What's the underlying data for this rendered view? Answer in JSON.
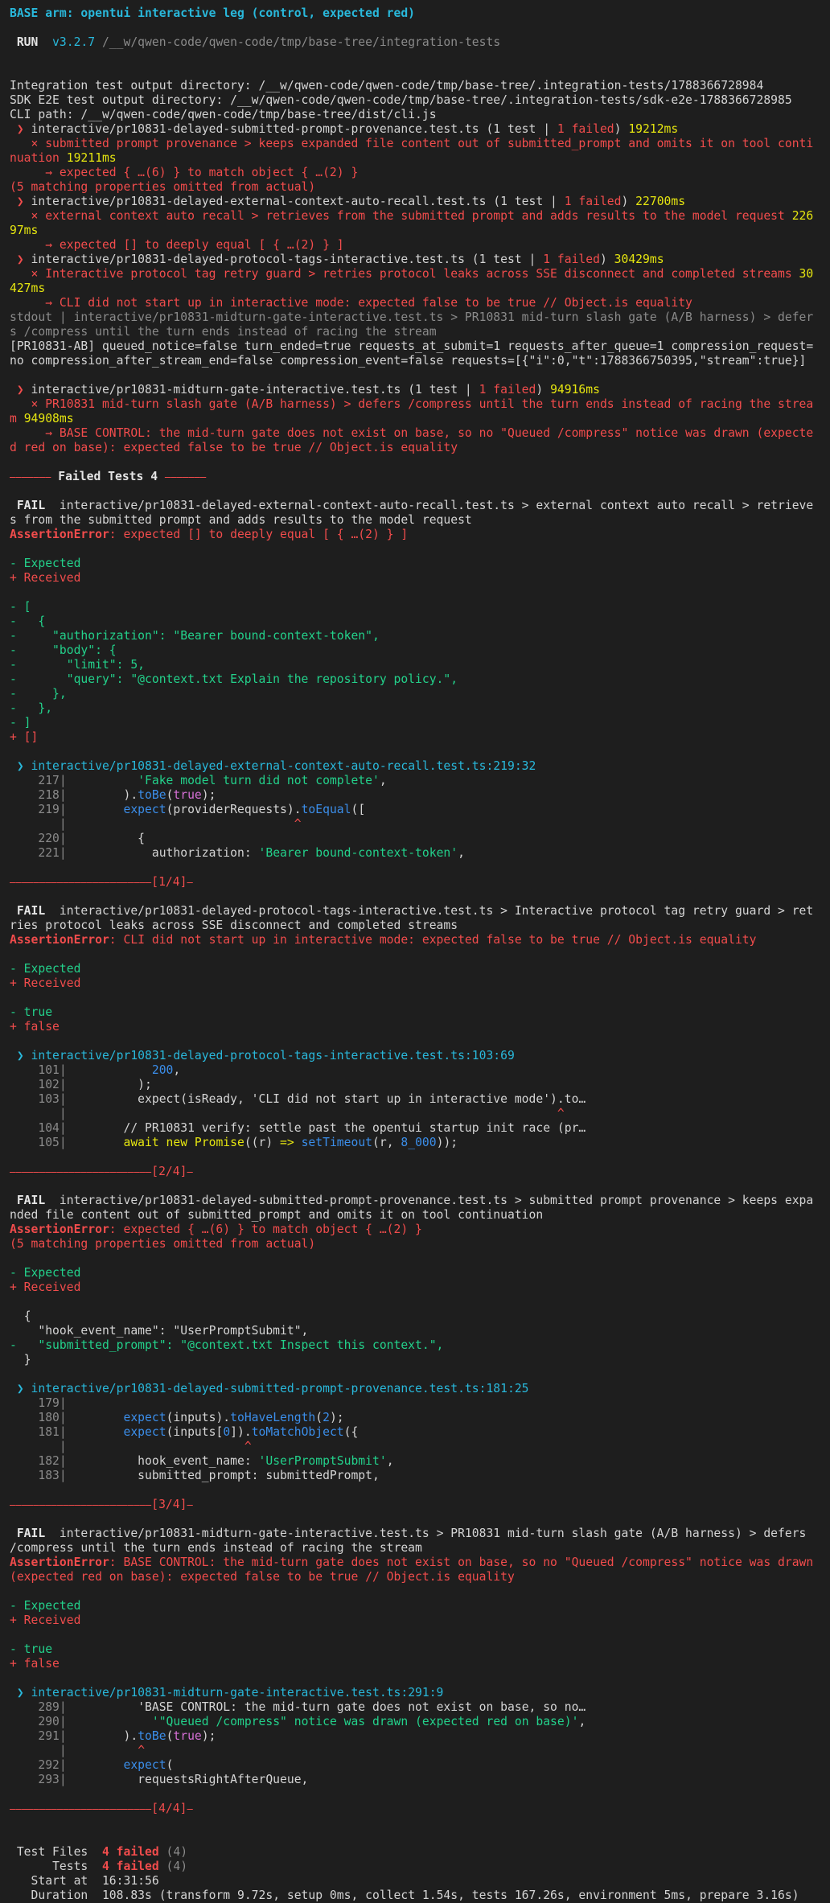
{
  "lines": [
    [
      {
        "t": "BASE arm: opentui interactive leg (control, expected red)",
        "c": "cyan b"
      }
    ],
    [],
    [
      {
        "t": " RUN ",
        "c": "white b"
      },
      {
        "t": " v3.2.7 ",
        "c": "cyan"
      },
      {
        "t": "/__w/qwen-code/qwen-code/tmp/base-tree/integration-tests",
        "c": "dim"
      }
    ],
    [],
    [],
    [
      {
        "t": "Integration test output directory: /__w/qwen-code/qwen-code/tmp/base-tree/.integration-tests/1788366728984",
        "c": ""
      }
    ],
    [
      {
        "t": "SDK E2E test output directory: /__w/qwen-code/qwen-code/tmp/base-tree/.integration-tests/sdk-e2e-1788366728985",
        "c": ""
      }
    ],
    [
      {
        "t": "CLI path: /__w/qwen-code/qwen-code/tmp/base-tree/dist/cli.js",
        "c": ""
      }
    ],
    [
      {
        "t": " ❯ ",
        "c": "red"
      },
      {
        "t": "interactive/pr10831-delayed-submitted-prompt-provenance.test.ts (1 test | ",
        "c": ""
      },
      {
        "t": "1 failed",
        "c": "red"
      },
      {
        "t": ") ",
        "c": ""
      },
      {
        "t": "19212ms",
        "c": "yel"
      }
    ],
    [
      {
        "t": "   × submitted prompt provenance > keeps expanded file content out of submitted_prompt and omits it on tool continuation ",
        "c": "red"
      },
      {
        "t": "19211ms",
        "c": "yel"
      }
    ],
    [
      {
        "t": "     → expected { …(6) } to match object { …(2) }",
        "c": "red"
      }
    ],
    [
      {
        "t": "(5 matching properties omitted from actual)",
        "c": "red"
      }
    ],
    [
      {
        "t": " ❯ ",
        "c": "red"
      },
      {
        "t": "interactive/pr10831-delayed-external-context-auto-recall.test.ts (1 test | ",
        "c": ""
      },
      {
        "t": "1 failed",
        "c": "red"
      },
      {
        "t": ") ",
        "c": ""
      },
      {
        "t": "22700ms",
        "c": "yel"
      }
    ],
    [
      {
        "t": "   × external context auto recall > retrieves from the submitted prompt and adds results to the model request ",
        "c": "red"
      },
      {
        "t": "22697ms",
        "c": "yel"
      }
    ],
    [
      {
        "t": "     → expected [] to deeply equal [ { …(2) } ]",
        "c": "red"
      }
    ],
    [
      {
        "t": " ❯ ",
        "c": "red"
      },
      {
        "t": "interactive/pr10831-delayed-protocol-tags-interactive.test.ts (1 test | ",
        "c": ""
      },
      {
        "t": "1 failed",
        "c": "red"
      },
      {
        "t": ") ",
        "c": ""
      },
      {
        "t": "30429ms",
        "c": "yel"
      }
    ],
    [
      {
        "t": "   × Interactive protocol tag retry guard > retries protocol leaks across SSE disconnect and completed streams ",
        "c": "red"
      },
      {
        "t": "30427ms",
        "c": "yel"
      }
    ],
    [
      {
        "t": "     → CLI did not start up in interactive mode: expected false to be true // Object.is equality",
        "c": "red"
      }
    ],
    [
      {
        "t": "stdout | interactive/pr10831-midturn-gate-interactive.test.ts > PR10831 mid-turn slash gate (A/B harness) > defers /compress until the turn ends instead of racing the stream",
        "c": "dim"
      }
    ],
    [
      {
        "t": "[PR10831-AB] queued_notice=false turn_ended=true requests_at_submit=1 requests_after_queue=1 compression_request=no compression_after_stream_end=false compression_event=false requests=[{\"i\":0,\"t\":1788366750395,\"stream\":true}]",
        "c": ""
      }
    ],
    [],
    [
      {
        "t": " ❯ ",
        "c": "red"
      },
      {
        "t": "interactive/pr10831-midturn-gate-interactive.test.ts (1 test | ",
        "c": ""
      },
      {
        "t": "1 failed",
        "c": "red"
      },
      {
        "t": ") ",
        "c": ""
      },
      {
        "t": "94916ms",
        "c": "yel"
      }
    ],
    [
      {
        "t": "   × PR10831 mid-turn slash gate (A/B harness) > defers /compress until the turn ends instead of racing the stream ",
        "c": "red"
      },
      {
        "t": "94908ms",
        "c": "yel"
      }
    ],
    [
      {
        "t": "     → BASE CONTROL: the mid-turn gate does not exist on base, so no \"Queued /compress\" notice was drawn (expected red on base): expected false to be true // Object.is equality",
        "c": "red"
      }
    ],
    [],
    [
      {
        "t": "⎯⎯⎯⎯⎯⎯⎯ ",
        "c": "red"
      },
      {
        "t": "Failed Tests 4",
        "c": "white b"
      },
      {
        "t": " ⎯⎯⎯⎯⎯⎯⎯",
        "c": "red"
      }
    ],
    [],
    [
      {
        "t": " FAIL ",
        "c": "white b"
      },
      {
        "t": " interactive/pr10831-delayed-external-context-auto-recall.test.ts > external context auto recall > retrieves from the submitted prompt and adds results to the model request",
        "c": ""
      }
    ],
    [
      {
        "t": "AssertionError",
        "c": "red b"
      },
      {
        "t": ": expected [] to deeply equal [ { …(2) } ]",
        "c": "red"
      }
    ],
    [],
    [
      {
        "t": "- Expected",
        "c": "green"
      }
    ],
    [
      {
        "t": "+ Received",
        "c": "red"
      }
    ],
    [],
    [
      {
        "t": "- [",
        "c": "green"
      }
    ],
    [
      {
        "t": "-   {",
        "c": "green"
      }
    ],
    [
      {
        "t": "-     \"authorization\": \"Bearer bound-context-token\",",
        "c": "green"
      }
    ],
    [
      {
        "t": "-     \"body\": {",
        "c": "green"
      }
    ],
    [
      {
        "t": "-       \"limit\": 5,",
        "c": "green"
      }
    ],
    [
      {
        "t": "-       \"query\": \"@context.txt Explain the repository policy.\",",
        "c": "green"
      }
    ],
    [
      {
        "t": "-     },",
        "c": "green"
      }
    ],
    [
      {
        "t": "-   },",
        "c": "green"
      }
    ],
    [
      {
        "t": "- ]",
        "c": "green"
      }
    ],
    [
      {
        "t": "+ []",
        "c": "red"
      }
    ],
    [],
    [
      {
        "t": " ❯ ",
        "c": "cyan"
      },
      {
        "t": "interactive/pr10831-delayed-external-context-auto-recall.test.ts:219:32",
        "c": "cyan"
      }
    ],
    [
      {
        "t": "    217",
        "c": "dim"
      },
      {
        "t": "|",
        "c": "dim"
      },
      {
        "t": "          ",
        "c": ""
      },
      {
        "t": "'Fake model turn did not complete'",
        "c": "green"
      },
      {
        "t": ",",
        "c": ""
      }
    ],
    [
      {
        "t": "    218",
        "c": "dim"
      },
      {
        "t": "|",
        "c": "dim"
      },
      {
        "t": "        ).",
        "c": ""
      },
      {
        "t": "toBe",
        "c": "blue"
      },
      {
        "t": "(",
        "c": ""
      },
      {
        "t": "true",
        "c": "mag"
      },
      {
        "t": ");",
        "c": ""
      }
    ],
    [
      {
        "t": "    219",
        "c": "dim"
      },
      {
        "t": "|",
        "c": "dim"
      },
      {
        "t": "        ",
        "c": ""
      },
      {
        "t": "expect",
        "c": "blue"
      },
      {
        "t": "(providerRequests).",
        "c": ""
      },
      {
        "t": "toEqual",
        "c": "blue"
      },
      {
        "t": "([",
        "c": ""
      }
    ],
    [
      {
        "t": "       ",
        "c": ""
      },
      {
        "t": "|",
        "c": "dim"
      },
      {
        "t": "                                ",
        "c": ""
      },
      {
        "t": "^",
        "c": "red"
      }
    ],
    [
      {
        "t": "    220",
        "c": "dim"
      },
      {
        "t": "|",
        "c": "dim"
      },
      {
        "t": "          {",
        "c": ""
      }
    ],
    [
      {
        "t": "    221",
        "c": "dim"
      },
      {
        "t": "|",
        "c": "dim"
      },
      {
        "t": "            authorization: ",
        "c": ""
      },
      {
        "t": "'Bearer bound-context-token'",
        "c": "green"
      },
      {
        "t": ",",
        "c": ""
      }
    ],
    [],
    [
      {
        "t": "⎯⎯⎯⎯⎯⎯⎯⎯⎯⎯⎯⎯⎯⎯⎯⎯⎯⎯⎯⎯⎯⎯⎯⎯[1/4]⎯",
        "c": "red"
      }
    ],
    [],
    [
      {
        "t": " FAIL ",
        "c": "white b"
      },
      {
        "t": " interactive/pr10831-delayed-protocol-tags-interactive.test.ts > Interactive protocol tag retry guard > retries protocol leaks across SSE disconnect and completed streams",
        "c": ""
      }
    ],
    [
      {
        "t": "AssertionError",
        "c": "red b"
      },
      {
        "t": ": CLI did not start up in interactive mode: expected false to be true // Object.is equality",
        "c": "red"
      }
    ],
    [],
    [
      {
        "t": "- Expected",
        "c": "green"
      }
    ],
    [
      {
        "t": "+ Received",
        "c": "red"
      }
    ],
    [],
    [
      {
        "t": "- true",
        "c": "green"
      }
    ],
    [
      {
        "t": "+ false",
        "c": "red"
      }
    ],
    [],
    [
      {
        "t": " ❯ ",
        "c": "cyan"
      },
      {
        "t": "interactive/pr10831-delayed-protocol-tags-interactive.test.ts:103:69",
        "c": "cyan"
      }
    ],
    [
      {
        "t": "    101",
        "c": "dim"
      },
      {
        "t": "|",
        "c": "dim"
      },
      {
        "t": "            ",
        "c": ""
      },
      {
        "t": "200",
        "c": "blue"
      },
      {
        "t": ",",
        "c": ""
      }
    ],
    [
      {
        "t": "    102",
        "c": "dim"
      },
      {
        "t": "|",
        "c": "dim"
      },
      {
        "t": "          );",
        "c": ""
      }
    ],
    [
      {
        "t": "    103",
        "c": "dim"
      },
      {
        "t": "|",
        "c": "dim"
      },
      {
        "t": "          expect(isReady, 'CLI did not start up in interactive mode').to…",
        "c": ""
      }
    ],
    [
      {
        "t": "       ",
        "c": ""
      },
      {
        "t": "|",
        "c": "dim"
      },
      {
        "t": "                                                                     ",
        "c": ""
      },
      {
        "t": "^",
        "c": "red"
      }
    ],
    [
      {
        "t": "    104",
        "c": "dim"
      },
      {
        "t": "|",
        "c": "dim"
      },
      {
        "t": "        // PR10831 verify: settle past the opentui startup init race (pr…",
        "c": ""
      }
    ],
    [
      {
        "t": "    105",
        "c": "dim"
      },
      {
        "t": "|",
        "c": "dim"
      },
      {
        "t": "        ",
        "c": ""
      },
      {
        "t": "await new Promise",
        "c": "yel"
      },
      {
        "t": "((r) ",
        "c": ""
      },
      {
        "t": "=>",
        "c": "yel"
      },
      {
        "t": " ",
        "c": ""
      },
      {
        "t": "setTimeout",
        "c": "blue"
      },
      {
        "t": "(r, ",
        "c": ""
      },
      {
        "t": "8_000",
        "c": "blue"
      },
      {
        "t": "));",
        "c": ""
      }
    ],
    [],
    [
      {
        "t": "⎯⎯⎯⎯⎯⎯⎯⎯⎯⎯⎯⎯⎯⎯⎯⎯⎯⎯⎯⎯⎯⎯⎯⎯[2/4]⎯",
        "c": "red"
      }
    ],
    [],
    [
      {
        "t": " FAIL ",
        "c": "white b"
      },
      {
        "t": " interactive/pr10831-delayed-submitted-prompt-provenance.test.ts > submitted prompt provenance > keeps expanded file content out of submitted_prompt and omits it on tool continuation",
        "c": ""
      }
    ],
    [
      {
        "t": "AssertionError",
        "c": "red b"
      },
      {
        "t": ": expected { …(6) } to match object { …(2) }",
        "c": "red"
      }
    ],
    [
      {
        "t": "(5 matching properties omitted from actual)",
        "c": "red"
      }
    ],
    [],
    [
      {
        "t": "- Expected",
        "c": "green"
      }
    ],
    [
      {
        "t": "+ Received",
        "c": "red"
      }
    ],
    [],
    [
      {
        "t": "  {",
        "c": ""
      }
    ],
    [
      {
        "t": "    \"hook_event_name\": \"UserPromptSubmit\",",
        "c": ""
      }
    ],
    [
      {
        "t": "-   \"submitted_prompt\": \"@context.txt Inspect this context.\",",
        "c": "green"
      }
    ],
    [
      {
        "t": "  }",
        "c": ""
      }
    ],
    [],
    [
      {
        "t": " ❯ ",
        "c": "cyan"
      },
      {
        "t": "interactive/pr10831-delayed-submitted-prompt-provenance.test.ts:181:25",
        "c": "cyan"
      }
    ],
    [
      {
        "t": "    179",
        "c": "dim"
      },
      {
        "t": "|",
        "c": "dim"
      }
    ],
    [
      {
        "t": "    180",
        "c": "dim"
      },
      {
        "t": "|",
        "c": "dim"
      },
      {
        "t": "        ",
        "c": ""
      },
      {
        "t": "expect",
        "c": "blue"
      },
      {
        "t": "(inputs).",
        "c": ""
      },
      {
        "t": "toHaveLength",
        "c": "blue"
      },
      {
        "t": "(",
        "c": ""
      },
      {
        "t": "2",
        "c": "blue"
      },
      {
        "t": ");",
        "c": ""
      }
    ],
    [
      {
        "t": "    181",
        "c": "dim"
      },
      {
        "t": "|",
        "c": "dim"
      },
      {
        "t": "        ",
        "c": ""
      },
      {
        "t": "expect",
        "c": "blue"
      },
      {
        "t": "(inputs[",
        "c": ""
      },
      {
        "t": "0",
        "c": "blue"
      },
      {
        "t": "]).",
        "c": ""
      },
      {
        "t": "toMatchObject",
        "c": "blue"
      },
      {
        "t": "({",
        "c": ""
      }
    ],
    [
      {
        "t": "       ",
        "c": ""
      },
      {
        "t": "|",
        "c": "dim"
      },
      {
        "t": "                         ",
        "c": ""
      },
      {
        "t": "^",
        "c": "red"
      }
    ],
    [
      {
        "t": "    182",
        "c": "dim"
      },
      {
        "t": "|",
        "c": "dim"
      },
      {
        "t": "          hook_event_name: ",
        "c": ""
      },
      {
        "t": "'UserPromptSubmit'",
        "c": "green"
      },
      {
        "t": ",",
        "c": ""
      }
    ],
    [
      {
        "t": "    183",
        "c": "dim"
      },
      {
        "t": "|",
        "c": "dim"
      },
      {
        "t": "          submitted_prompt: submittedPrompt,",
        "c": ""
      }
    ],
    [],
    [
      {
        "t": "⎯⎯⎯⎯⎯⎯⎯⎯⎯⎯⎯⎯⎯⎯⎯⎯⎯⎯⎯⎯⎯⎯⎯⎯[3/4]⎯",
        "c": "red"
      }
    ],
    [],
    [
      {
        "t": " FAIL ",
        "c": "white b"
      },
      {
        "t": " interactive/pr10831-midturn-gate-interactive.test.ts > PR10831 mid-turn slash gate (A/B harness) > defers /compress until the turn ends instead of racing the stream",
        "c": ""
      }
    ],
    [
      {
        "t": "AssertionError",
        "c": "red b"
      },
      {
        "t": ": BASE CONTROL: the mid-turn gate does not exist on base, so no \"Queued /compress\" notice was drawn (expected red on base): expected false to be true // Object.is equality",
        "c": "red"
      }
    ],
    [],
    [
      {
        "t": "- Expected",
        "c": "green"
      }
    ],
    [
      {
        "t": "+ Received",
        "c": "red"
      }
    ],
    [],
    [
      {
        "t": "- true",
        "c": "green"
      }
    ],
    [
      {
        "t": "+ false",
        "c": "red"
      }
    ],
    [],
    [
      {
        "t": " ❯ ",
        "c": "cyan"
      },
      {
        "t": "interactive/pr10831-midturn-gate-interactive.test.ts:291:9",
        "c": "cyan"
      }
    ],
    [
      {
        "t": "    289",
        "c": "dim"
      },
      {
        "t": "|",
        "c": "dim"
      },
      {
        "t": "          ",
        "c": ""
      },
      {
        "t": "'BASE CONTROL: the mid-turn gate does not exist on base, so no…",
        "c": ""
      }
    ],
    [
      {
        "t": "    290",
        "c": "dim"
      },
      {
        "t": "|",
        "c": "dim"
      },
      {
        "t": "            ",
        "c": ""
      },
      {
        "t": "'\"Queued /compress\" notice was drawn (expected red on base)'",
        "c": "green"
      },
      {
        "t": ",",
        "c": ""
      }
    ],
    [
      {
        "t": "    291",
        "c": "dim"
      },
      {
        "t": "|",
        "c": "dim"
      },
      {
        "t": "        ).",
        "c": ""
      },
      {
        "t": "toBe",
        "c": "blue"
      },
      {
        "t": "(",
        "c": ""
      },
      {
        "t": "true",
        "c": "mag"
      },
      {
        "t": ");",
        "c": ""
      }
    ],
    [
      {
        "t": "       ",
        "c": ""
      },
      {
        "t": "|",
        "c": "dim"
      },
      {
        "t": "          ",
        "c": ""
      },
      {
        "t": "^",
        "c": "red"
      }
    ],
    [
      {
        "t": "    292",
        "c": "dim"
      },
      {
        "t": "|",
        "c": "dim"
      },
      {
        "t": "        ",
        "c": ""
      },
      {
        "t": "expect",
        "c": "blue"
      },
      {
        "t": "(",
        "c": ""
      }
    ],
    [
      {
        "t": "    293",
        "c": "dim"
      },
      {
        "t": "|",
        "c": "dim"
      },
      {
        "t": "          requestsRightAfterQueue,",
        "c": ""
      }
    ],
    [],
    [
      {
        "t": "⎯⎯⎯⎯⎯⎯⎯⎯⎯⎯⎯⎯⎯⎯⎯⎯⎯⎯⎯⎯⎯⎯⎯⎯[4/4]⎯",
        "c": "red"
      }
    ],
    [],
    [],
    [
      {
        "t": " Test Files  ",
        "c": ""
      },
      {
        "t": "4 failed",
        "c": "red b"
      },
      {
        "t": " (4)",
        "c": "dim"
      }
    ],
    [
      {
        "t": "      Tests  ",
        "c": ""
      },
      {
        "t": "4 failed",
        "c": "red b"
      },
      {
        "t": " (4)",
        "c": "dim"
      }
    ],
    [
      {
        "t": "   Start at  ",
        "c": ""
      },
      {
        "t": "16:31:56",
        "c": ""
      }
    ],
    [
      {
        "t": "   Duration  ",
        "c": ""
      },
      {
        "t": "108.83s (transform 9.72s, setup 0ms, collect 1.54s, tests 167.26s, environment 5ms, prepare 3.16s)",
        "c": ""
      }
    ]
  ]
}
